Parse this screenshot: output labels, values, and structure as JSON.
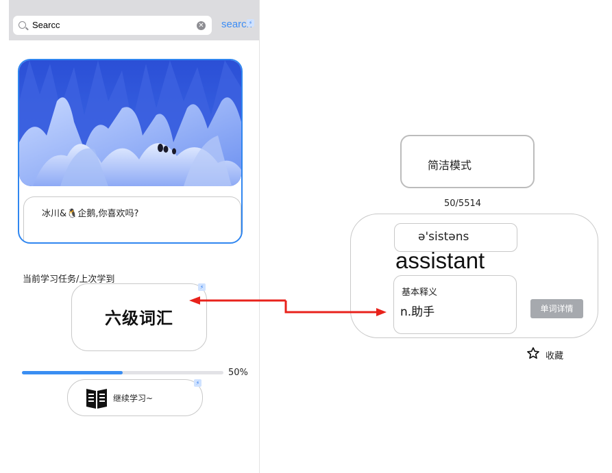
{
  "search": {
    "value": "Searcc",
    "clear_icon": "clear-icon",
    "button_label": "search",
    "badge": "⚡"
  },
  "feature": {
    "caption": "冰川&🐧企鹅,你喜欢吗?"
  },
  "task": {
    "label": "当前学习任务/上次学到",
    "title": "六级词汇",
    "badge": "⚡"
  },
  "progress": {
    "value": 0.5,
    "text": "50%"
  },
  "continue": {
    "label": "继续学习~",
    "icon": "book-icon",
    "badge": "⚡"
  },
  "mode": {
    "label": "简洁模式"
  },
  "counter": "50/5514",
  "word_card": {
    "phonetic": "ə'sistəns",
    "word": "assistant",
    "meaning_heading": "基本释义",
    "meaning": "n.助手",
    "detail_button": "单词详情"
  },
  "favorite": {
    "label": "收藏",
    "icon": "star-outline-icon"
  },
  "colors": {
    "accent": "#2f86f0",
    "arrow": "#e8221b",
    "progress_fill": "#3a8ef2"
  }
}
